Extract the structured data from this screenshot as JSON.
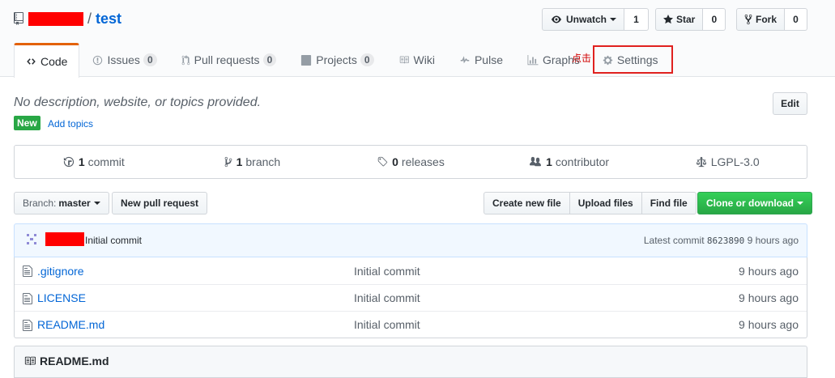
{
  "repo": {
    "name": "test",
    "separator": "/"
  },
  "actions": {
    "watch": {
      "label": "Unwatch",
      "count": "1"
    },
    "star": {
      "label": "Star",
      "count": "0"
    },
    "fork": {
      "label": "Fork",
      "count": "0"
    }
  },
  "tabs": [
    {
      "label": "Code",
      "count": null,
      "icon": "code-icon",
      "selected": true
    },
    {
      "label": "Issues",
      "count": "0",
      "icon": "issue-icon"
    },
    {
      "label": "Pull requests",
      "count": "0",
      "icon": "pull-request-icon"
    },
    {
      "label": "Projects",
      "count": "0",
      "icon": "project-icon"
    },
    {
      "label": "Wiki",
      "count": null,
      "icon": "book-icon"
    },
    {
      "label": "Pulse",
      "count": null,
      "icon": "pulse-icon"
    },
    {
      "label": "Graphs",
      "count": null,
      "icon": "graph-icon"
    },
    {
      "label": "Settings",
      "count": null,
      "icon": "gear-icon"
    }
  ],
  "annotation": {
    "text": "点击",
    "color": "#e0211f"
  },
  "description": {
    "text": "No description, website, or topics provided.",
    "edit_label": "Edit",
    "new_badge": "New",
    "add_topics": "Add topics"
  },
  "summary": [
    {
      "count": "1",
      "label": "commit",
      "icon": "history-icon"
    },
    {
      "count": "1",
      "label": "branch",
      "icon": "branch-icon"
    },
    {
      "count": "0",
      "label": "releases",
      "icon": "tag-icon"
    },
    {
      "count": "1",
      "label": "contributor",
      "icon": "people-icon"
    },
    {
      "count": "",
      "label": "LGPL-3.0",
      "icon": "law-icon"
    }
  ],
  "file_nav": {
    "branch_prefix": "Branch:",
    "branch_name": "master",
    "new_pull_request": "New pull request",
    "create_new_file": "Create new file",
    "upload_files": "Upload files",
    "find_file": "Find file",
    "clone_or_download": "Clone or download"
  },
  "latest_commit": {
    "message": "Initial commit",
    "prefix": "Latest commit",
    "sha": "8623890",
    "age": "9 hours ago"
  },
  "files": [
    {
      "name": ".gitignore",
      "message": "Initial commit",
      "age": "9 hours ago"
    },
    {
      "name": "LICENSE",
      "message": "Initial commit",
      "age": "9 hours ago"
    },
    {
      "name": "README.md",
      "message": "Initial commit",
      "age": "9 hours ago"
    }
  ],
  "readme": {
    "title": "README.md"
  },
  "colors": {
    "accent": "#0366d6",
    "tab_active": "#e36209",
    "green": "#28a745",
    "redaction": "#ff0000"
  }
}
